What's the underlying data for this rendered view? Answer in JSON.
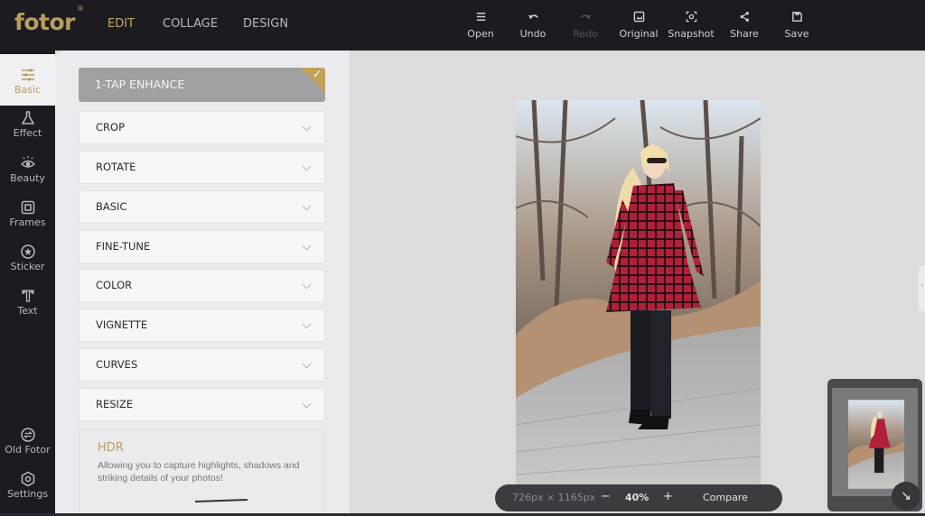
{
  "app": {
    "logo": "fotor",
    "logo_mark": "®",
    "nav": [
      {
        "label": "EDIT",
        "active": true
      },
      {
        "label": "COLLAGE",
        "active": false
      },
      {
        "label": "DESIGN",
        "active": false
      }
    ]
  },
  "toolbar": {
    "items": [
      {
        "label": "Open",
        "icon": "menu-icon",
        "enabled": true
      },
      {
        "label": "Undo",
        "icon": "undo-icon",
        "enabled": true
      },
      {
        "label": "Redo",
        "icon": "redo-icon",
        "enabled": false
      },
      {
        "label": "Original",
        "icon": "image-icon",
        "enabled": true
      },
      {
        "label": "Snapshot",
        "icon": "snapshot-icon",
        "enabled": true
      },
      {
        "label": "Share",
        "icon": "share-icon",
        "enabled": true
      },
      {
        "label": "Save",
        "icon": "save-icon",
        "enabled": true
      }
    ]
  },
  "sidebar": {
    "items": [
      {
        "label": "Basic",
        "icon": "sliders-icon",
        "active": true
      },
      {
        "label": "Effect",
        "icon": "flask-icon",
        "active": false
      },
      {
        "label": "Beauty",
        "icon": "eye-icon",
        "active": false
      },
      {
        "label": "Frames",
        "icon": "frame-icon",
        "active": false
      },
      {
        "label": "Sticker",
        "icon": "star-badge-icon",
        "active": false
      },
      {
        "label": "Text",
        "icon": "text-icon",
        "active": false
      }
    ],
    "bottom_items": [
      {
        "label": "Old Fotor",
        "icon": "switch-icon"
      },
      {
        "label": "Settings",
        "icon": "gear-icon"
      }
    ]
  },
  "panel": {
    "enhance_label": "1-TAP ENHANCE",
    "sections": [
      "CROP",
      "ROTATE",
      "BASIC",
      "FINE-TUNE",
      "COLOR",
      "VIGNETTE",
      "CURVES",
      "RESIZE"
    ],
    "hdr": {
      "title": "HDR",
      "description": "Allowing you to capture highlights, shadows and striking details of your photos!"
    }
  },
  "canvas": {
    "dimensions": "726px × 1165px",
    "zoom_out": "−",
    "zoom_level": "40%",
    "zoom_in": "+",
    "compare_label": "Compare",
    "side_tab_glyph": "›",
    "navigator_button": "↘"
  },
  "colors": {
    "accent": "#b79d5e",
    "topbar_bg": "#1c1b21",
    "panel_bg": "#ebebef",
    "canvas_bg": "#dcdcdc"
  }
}
